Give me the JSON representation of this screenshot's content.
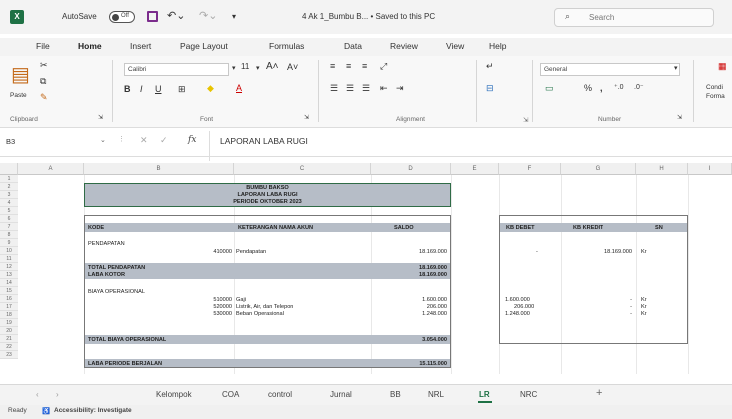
{
  "titlebar": {
    "autosave": "AutoSave",
    "toggle": "Off",
    "filename": "4 Ak 1_Bumbu B... • Saved to this PC",
    "search_placeholder": "Search"
  },
  "menu": [
    "File",
    "Home",
    "Insert",
    "Page Layout",
    "Formulas",
    "Data",
    "Review",
    "View",
    "Help"
  ],
  "ribbon": {
    "paste": "Paste",
    "clipboard": "Clipboard",
    "font_name": "Calibri",
    "font_size": "11",
    "font": "Font",
    "alignment": "Alignment",
    "number_format": "General",
    "number": "Number",
    "conditional": "Condi",
    "format": "Forma"
  },
  "formula_bar": {
    "name_box": "B3",
    "fx": "fx",
    "content": "LAPORAN LABA RUGI"
  },
  "columns": [
    "A",
    "B",
    "C",
    "D",
    "E",
    "F",
    "G",
    "H",
    "I"
  ],
  "rows": [
    "1",
    "2",
    "3",
    "4",
    "5",
    "6",
    "7",
    "8",
    "9",
    "10",
    "11",
    "12",
    "13",
    "14",
    "15",
    "16",
    "17",
    "18",
    "19",
    "20",
    "21",
    "22",
    "23"
  ],
  "report": {
    "title1": "BUMBU BAKSO",
    "title2": "LAPORAN LABA RUGI",
    "title3": "PERIODE OKTOBER 2023",
    "col_kode": "KODE",
    "col_ket": "KETERANGAN NAMA AKUN",
    "col_saldo": "SALDO",
    "col_debet": "KB DEBET",
    "col_kredit": "KB KREDIT",
    "col_sn": "SN",
    "pendapatan": "PENDAPATAN",
    "pend_kode": "410000",
    "pend_ket": "Pendapatan",
    "pend_saldo": "18.169.000",
    "pend_debet": "-",
    "pend_kredit": "18.169.000",
    "pend_sn": "Kr",
    "total_pend": "TOTAL PENDAPATAN",
    "total_pend_val": "18.169.000",
    "laba_kotor": "LABA KOTOR",
    "laba_kotor_val": "18.169.000",
    "biaya_op": "BIAYA OPERASIONAL",
    "b1_kode": "510000",
    "b1_ket": "Gaji",
    "b1_saldo": "1.600.000",
    "b1_debet": "1.600.000",
    "b1_kredit": "-",
    "b1_sn": "Kr",
    "b2_kode": "520000",
    "b2_ket": "Listrik, Air, dan Telepon",
    "b2_saldo": "206.000",
    "b2_debet": "206.000",
    "b2_kredit": "-",
    "b2_sn": "Kr",
    "b3_kode": "530000",
    "b3_ket": "Beban Operasional",
    "b3_saldo": "1.248.000",
    "b3_debet": "1.248.000",
    "b3_kredit": "-",
    "b3_sn": "Kr",
    "total_biaya": "TOTAL BIAYA OPERASIONAL",
    "total_biaya_val": "3.054.000",
    "laba_berjalan": "LABA PERIODE BERJALAN",
    "laba_berjalan_val": "15.115.000"
  },
  "sheet_tabs": [
    "Kelompok",
    "COA",
    "control",
    "Jurnal",
    "BB",
    "NRL",
    "LR",
    "NRC",
    "+"
  ],
  "status": {
    "ready": "Ready",
    "accessibility": "Accessibility: Investigate"
  },
  "colors": {
    "accent": "#1e7145",
    "header_band": "#b6bdc7"
  }
}
